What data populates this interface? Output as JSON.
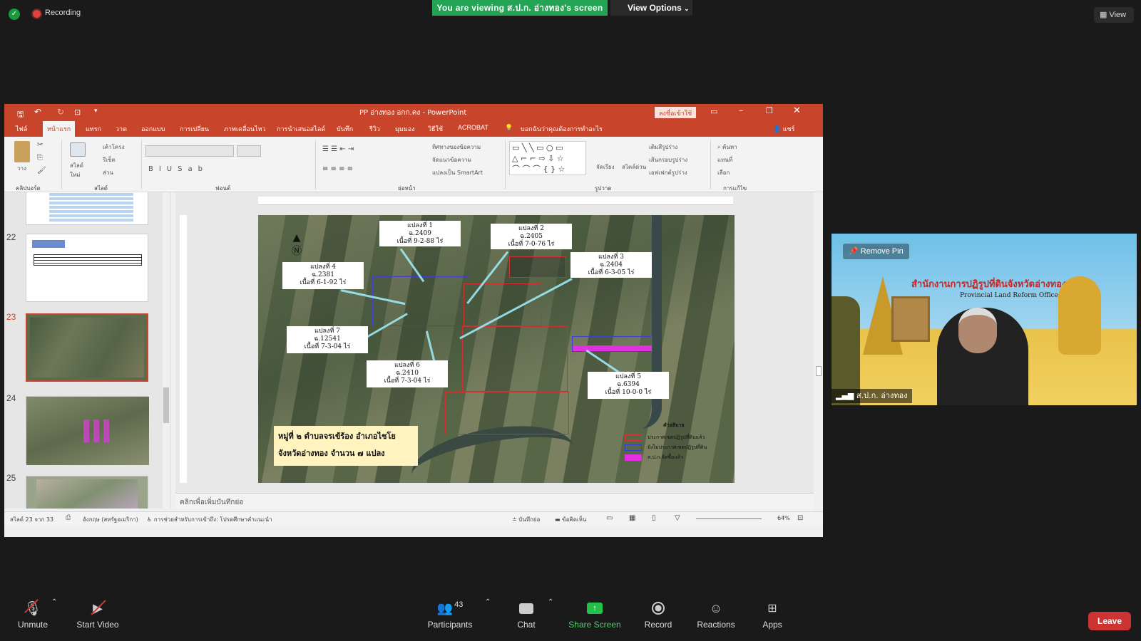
{
  "zoom": {
    "recording_label": "Recording",
    "viewing_banner": "You are viewing ส.ป.ก. อ่างทอง's screen",
    "view_options": "View Options",
    "view_button": "View",
    "toolbar": {
      "unmute": "Unmute",
      "start_video": "Start Video",
      "participants": "Participants",
      "participants_count": "43",
      "chat": "Chat",
      "share_screen": "Share Screen",
      "record": "Record",
      "reactions": "Reactions",
      "apps": "Apps",
      "leave": "Leave"
    },
    "video": {
      "remove_pin": "Remove Pin",
      "participant_name": "ส.ป.ก. อ่างทอง",
      "banner_text": "สำนักงานการปฏิรูปที่ดินจังหวัดอ่างทอง",
      "banner_sub": "Provincial Land Reform Office"
    }
  },
  "ppt": {
    "title": "PP อ่างทอง อกก.คง - PowerPoint",
    "signin": "ลงชื่อเข้าใช้",
    "tabs": [
      "ไฟล์",
      "หน้าแรก",
      "แทรก",
      "วาด",
      "ออกแบบ",
      "การเปลี่ยน",
      "ภาพเคลื่อนไหว",
      "การนำเสนอสไลด์",
      "บันทึก",
      "รีวิว",
      "มุมมอง",
      "วิธีใช้",
      "ACROBAT"
    ],
    "tell_me": "บอกฉันว่าคุณต้องการทำอะไร",
    "share": "แชร์",
    "groups": [
      "คลิปบอร์ด",
      "สไลด์",
      "ฟอนต์",
      "ย่อหน้า",
      "รูปวาด",
      "การแก้ไข"
    ],
    "ribbon_items": {
      "paste": "วาง",
      "new_slide": "สไลด์ใหม่",
      "layout": "เค้าโครง",
      "reset": "รีเซ็ต",
      "section": "ส่วน",
      "text_direction": "ทิศทางของข้อความ",
      "align_text": "จัดแนวข้อความ",
      "smartart": "แปลงเป็น SmartArt",
      "arrange": "จัดเรียง",
      "quick_styles": "สไตล์ด่วน",
      "shape_fill": "เติมสีรูปร่าง",
      "shape_outline": "เส้นกรอบรูปร่าง",
      "shape_effects": "เอฟเฟกต์รูปร่าง",
      "find": "ค้นหา",
      "replace": "แทนที่",
      "select": "เลือก"
    },
    "thumb_numbers": [
      "22",
      "23",
      "24",
      "25"
    ],
    "notes_placeholder": "คลิกเพื่อเพิ่มบันทึกย่อ",
    "status": {
      "slide_of": "สไลด์ 23 จาก 33",
      "language": "อังกฤษ (สหรัฐอเมริกา)",
      "accessibility": "การช่วยสำหรับการเข้าถึง: โปรดศึกษาคำแนะนำ",
      "notes": "บันทึกย่อ",
      "comments": "ข้อคิดเห็น",
      "zoom": "64%"
    },
    "slide": {
      "caption_line1": "หมู่ที่ ๒ ตำบลจรเข้ร้อง อำเภอไชโย",
      "caption_line2": "จังหวัดอ่างทอง จำนวน ๗ แปลง",
      "legend_title": "คำอธิบาย",
      "legend": [
        {
          "label": "ประกาศเขตปฏิรูปที่ดินแล้ว",
          "color": "#e03030"
        },
        {
          "label": "ยังไม่ประกาศเขตปฏิรูปที่ดิน",
          "color": "#3040d0"
        },
        {
          "label": "ส.ป.ก.จัดซื้อแล้ว",
          "color": "#e030e0"
        }
      ],
      "plots": [
        {
          "title": "แปลงที่ 1",
          "id": "ฉ.2409",
          "area": "เนื้อที่ 9-2-88 ไร่"
        },
        {
          "title": "แปลงที่ 2",
          "id": "ฉ.2405",
          "area": "เนื้อที่ 7-0-76 ไร่"
        },
        {
          "title": "แปลงที่ 3",
          "id": "ฉ.2404",
          "area": "เนื้อที่ 6-3-05 ไร่"
        },
        {
          "title": "แปลงที่ 4",
          "id": "ฉ.2381",
          "area": "เนื้อที่ 6-1-92 ไร่"
        },
        {
          "title": "แปลงที่ 5",
          "id": "ฉ.6394",
          "area": "เนื้อที่ 10-0-0 ไร่"
        },
        {
          "title": "แปลงที่ 6",
          "id": "ฉ.2410",
          "area": "เนื้อที่ 7-3-04 ไร่"
        },
        {
          "title": "แปลงที่ 7",
          "id": "ฉ.12541",
          "area": "เนื้อที่ 7-3-04 ไร่"
        }
      ]
    }
  }
}
